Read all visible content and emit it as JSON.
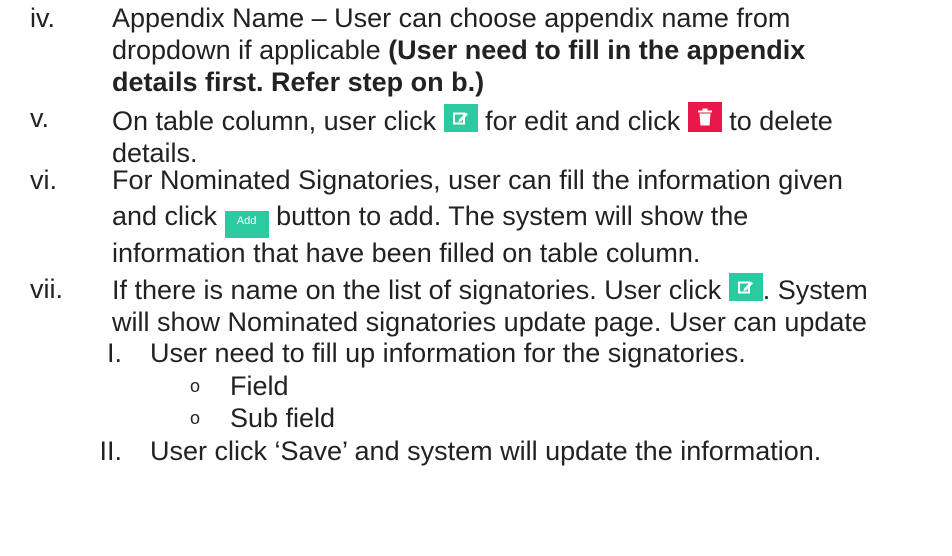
{
  "items": [
    {
      "num": "iv.",
      "line1": "Appendix Name – User can choose appendix name from",
      "line2_plain": "dropdown if applicable ",
      "line2_bold": "(User need to fill in the appendix",
      "line3_bold": "details first. Refer step on b.)"
    },
    {
      "num": "v.",
      "part1": "On table column, user click ",
      "part2": " for edit and click ",
      "part3": " to delete",
      "line2": "details."
    },
    {
      "num": "vi.",
      "line1": "For Nominated Signatories, user can fill the information given",
      "line2_pre": "and click ",
      "add_button_label": "Add",
      "line2_post": " button to add. The system will show the",
      "line3": "information that have been filled on table column."
    },
    {
      "num": "vii.",
      "line1_pre": "If there is name on the list of signatories. User click ",
      "line1_post": ". System",
      "line2": "will show Nominated signatories update page. User can update"
    }
  ],
  "sub_items": [
    {
      "num": "I.",
      "text": "User need to fill up information for the signatories.",
      "bullets": [
        "Field",
        "Sub field"
      ],
      "bullet_glyph": "o"
    },
    {
      "num": "II.",
      "text": "User click ‘Save’ and system will update the information."
    }
  ],
  "colors": {
    "edit_button": "#2dc9a0",
    "delete_button": "#e8194a",
    "add_button": "#2dc9a0"
  },
  "icons": {
    "edit": "pencil-square-icon",
    "delete": "trash-icon"
  }
}
